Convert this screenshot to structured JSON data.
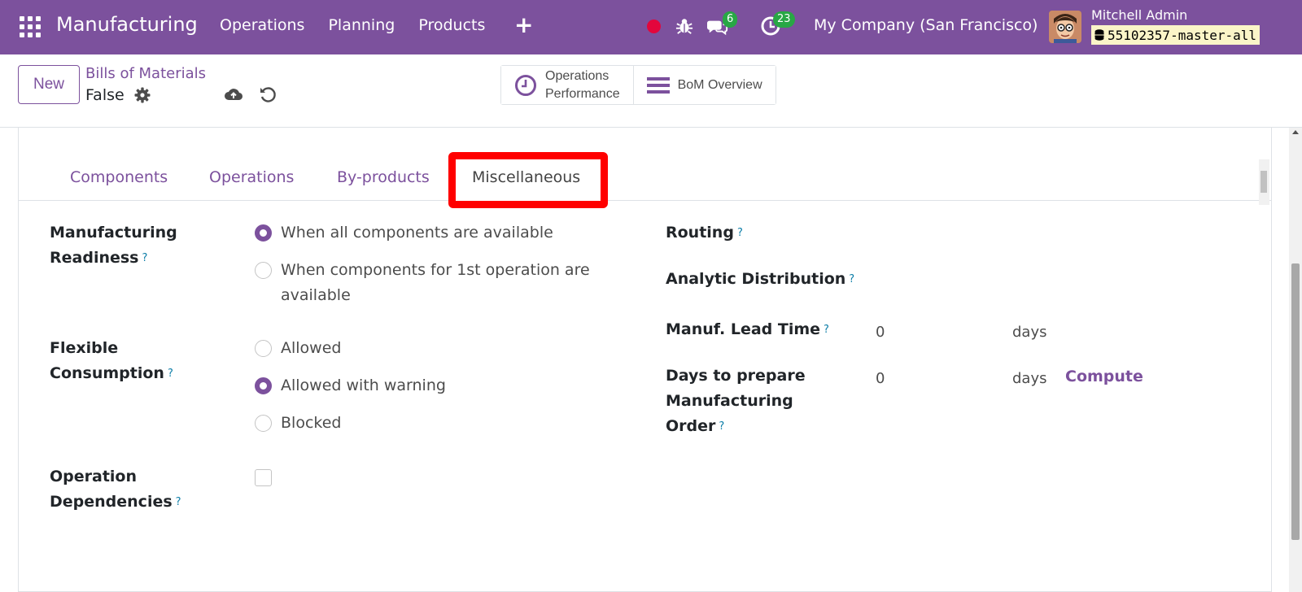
{
  "navbar": {
    "brand": "Manufacturing",
    "menu": [
      "Operations",
      "Planning",
      "Products"
    ],
    "plus": "+",
    "messages_badge": "6",
    "activities_badge": "23",
    "company": "My Company (San Francisco)",
    "user_name": "Mitchell Admin",
    "db_name": "55102357-master-all",
    "accent_color": "#7c519d"
  },
  "control_panel": {
    "new_label": "New",
    "breadcrumb": "Bills of Materials",
    "record_name": "False",
    "smart_buttons": [
      {
        "icon": "clock-icon",
        "line1": "Operations",
        "line2": "Performance"
      },
      {
        "icon": "bars-icon",
        "line1": "BoM Overview",
        "line2": ""
      }
    ]
  },
  "tabs": [
    {
      "label": "Components",
      "active": false
    },
    {
      "label": "Operations",
      "active": false
    },
    {
      "label": "By-products",
      "active": false
    },
    {
      "label": "Miscellaneous",
      "active": true
    }
  ],
  "misc": {
    "manufacturing_readiness": {
      "label_line1": "Manufacturing",
      "label_line2": "Readiness",
      "options": [
        {
          "line1": "When all components are available",
          "line2": "",
          "selected": true
        },
        {
          "line1": "When components for 1st operation are",
          "line2": "available",
          "selected": false
        }
      ]
    },
    "flexible_consumption": {
      "label_line1": "Flexible",
      "label_line2": "Consumption",
      "options": [
        {
          "label": "Allowed",
          "selected": false
        },
        {
          "label": "Allowed with warning",
          "selected": true
        },
        {
          "label": "Blocked",
          "selected": false
        }
      ]
    },
    "operation_dependencies": {
      "label_line1": "Operation",
      "label_line2": "Dependencies",
      "checked": false
    },
    "routing_label": "Routing",
    "analytic_label": "Analytic Distribution",
    "lead_time": {
      "label": "Manuf. Lead Time",
      "value": "0",
      "unit": "days"
    },
    "days_prepare": {
      "label_line1": "Days to prepare",
      "label_line2": "Manufacturing",
      "label_line3": "Order",
      "value": "0",
      "unit": "days",
      "compute_label": "Compute"
    },
    "help_mark": "?"
  }
}
